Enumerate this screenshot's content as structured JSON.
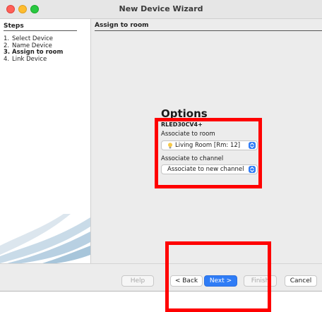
{
  "window": {
    "title": "New Device Wizard"
  },
  "steps": {
    "heading": "Steps",
    "items": [
      {
        "num": "1.",
        "label": "Select Device"
      },
      {
        "num": "2.",
        "label": "Name Device"
      },
      {
        "num": "3.",
        "label": "Assign to room",
        "current": true
      },
      {
        "num": "4.",
        "label": "Link Device"
      }
    ]
  },
  "main": {
    "heading": "Assign to room",
    "options_title": "Options",
    "device_name": "RLED30CV4+",
    "room_label": "Associate to room",
    "room_value": "Living Room [Rm: 12]",
    "channel_label": "Associate to channel",
    "channel_value": "Associate to new channel"
  },
  "buttons": {
    "help": "Help",
    "back": "< Back",
    "next": "Next >",
    "finish": "Finish",
    "cancel": "Cancel"
  },
  "colors": {
    "accent": "#2f7cf6",
    "highlight": "#ff0000"
  },
  "icons": {
    "room": "lightbulb-icon",
    "select_arrow": "up-down-chevron-icon"
  }
}
